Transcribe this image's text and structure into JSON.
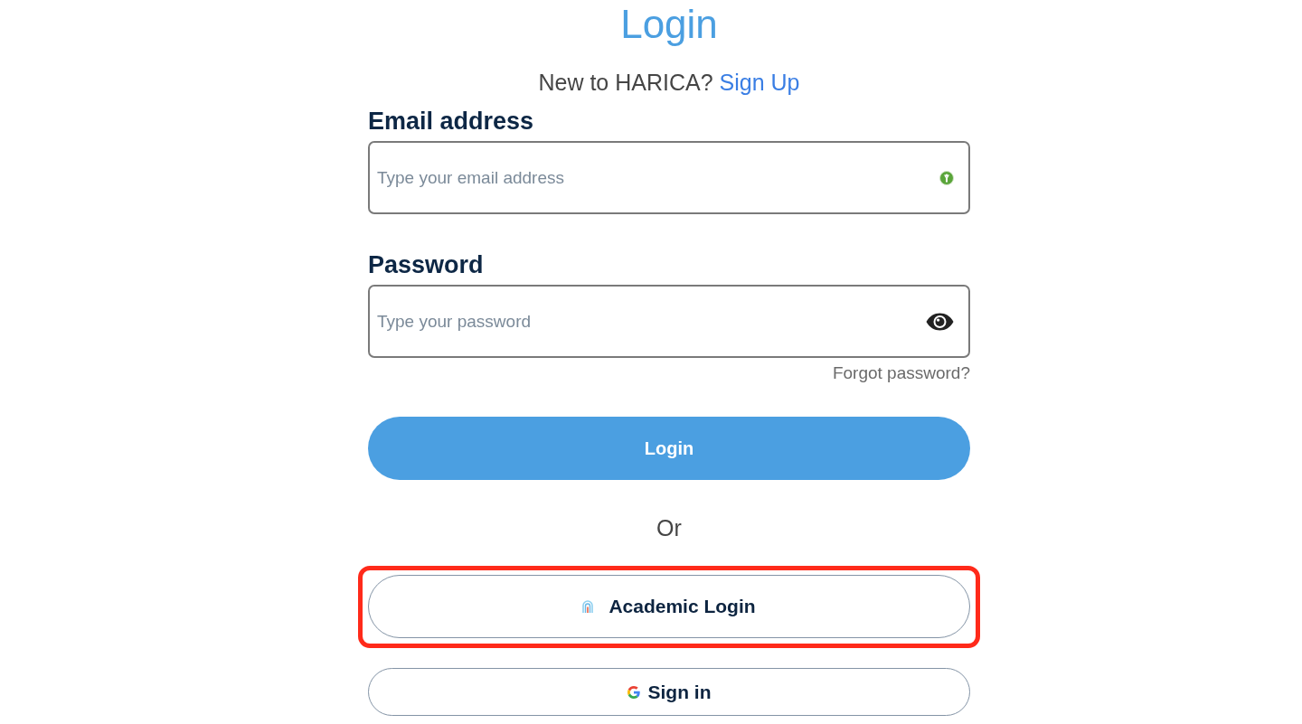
{
  "title": "Login",
  "signup_prompt": {
    "text": "New to HARICA?",
    "link": "Sign Up"
  },
  "fields": [
    {
      "label": "Email address",
      "placeholder": "Type your email address",
      "kind": "email"
    },
    {
      "label": "Password",
      "placeholder": "Type your password",
      "kind": "password"
    }
  ],
  "forgot_password_link": "Forgot password?",
  "login_button": "Login",
  "separator": "Or",
  "alternative_logins": [
    {
      "label": "Academic Login",
      "kind": "academic",
      "highlighted": true
    },
    {
      "label": "Sign in",
      "kind": "google",
      "highlighted": false
    }
  ]
}
